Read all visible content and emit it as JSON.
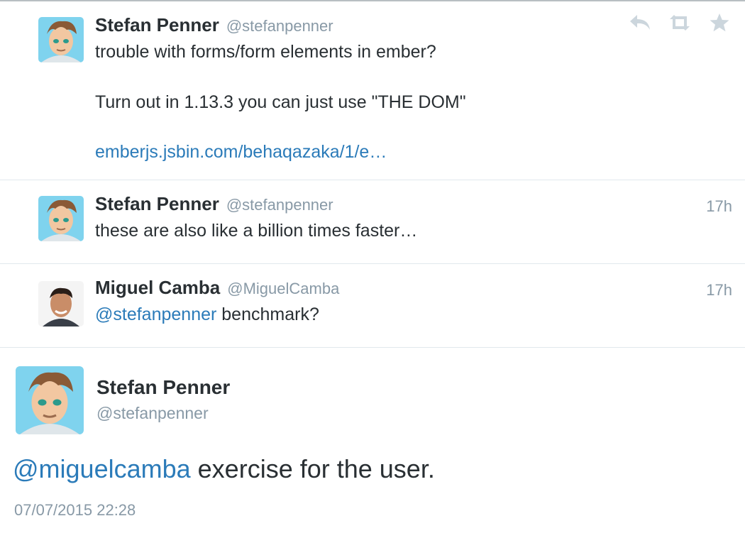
{
  "colors": {
    "link": "#2b7bb9",
    "muted": "#8899a6",
    "text": "#292f33",
    "divider": "#e1e8ed"
  },
  "tweets": [
    {
      "name": "Stefan Penner",
      "handle": "@stefanpenner",
      "avatar": "cartoon-avatar",
      "lines": [
        "trouble with forms/form elements in ember?",
        "Turn out in 1.13.3 you can just use \"THE DOM\""
      ],
      "link": "emberjs.jsbin.com/behaqazaka/1/e…",
      "actions": [
        "reply-icon",
        "retweet-icon",
        "favorite-icon"
      ]
    },
    {
      "name": "Stefan Penner",
      "handle": "@stefanpenner",
      "avatar": "cartoon-avatar",
      "time": "17h",
      "text": "these are also like a billion times faster…"
    },
    {
      "name": "Miguel Camba",
      "handle": "@MiguelCamba",
      "avatar": "photo-avatar",
      "time": "17h",
      "mention": "@stefanpenner",
      "text": " benchmark?"
    }
  ],
  "expanded": {
    "name": "Stefan Penner",
    "handle": "@stefanpenner",
    "mention": "@miguelcamba",
    "text": " exercise for the user.",
    "date": "07/07/2015 22:28"
  }
}
